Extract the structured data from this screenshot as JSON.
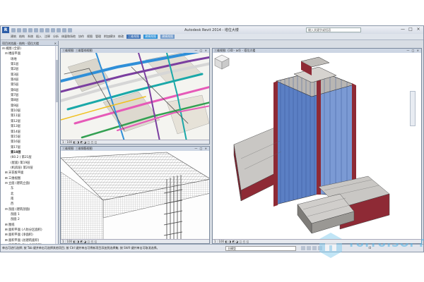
{
  "app": {
    "logo": "R",
    "title": "Autodesk Revit 2014 - 塔位大楼",
    "search_placeholder": "输入关键字或短语",
    "window_controls": [
      "—",
      "□",
      "×"
    ]
  },
  "ribbon": {
    "tabs": [
      {
        "label": "建筑",
        "style": ""
      },
      {
        "label": "结构",
        "style": ""
      },
      {
        "label": "系统",
        "style": ""
      },
      {
        "label": "插入",
        "style": ""
      },
      {
        "label": "注释",
        "style": ""
      },
      {
        "label": "分析",
        "style": ""
      },
      {
        "label": "体量和场地",
        "style": ""
      },
      {
        "label": "协作",
        "style": ""
      },
      {
        "label": "视图",
        "style": ""
      },
      {
        "label": "管理",
        "style": ""
      },
      {
        "label": "附加模块",
        "style": ""
      },
      {
        "label": "修改",
        "style": ""
      },
      {
        "label": "三维视图",
        "style": "hl"
      },
      {
        "label": "建模视图",
        "style": "hl2"
      },
      {
        "label": "建模视图",
        "style": "hl3"
      }
    ]
  },
  "browser": {
    "title": "项目浏览器 - 结构 - 塔位大楼",
    "close": "×",
    "items": [
      {
        "label": "⊟ 视图 (全部)",
        "indent": 0,
        "selected": false
      },
      {
        "label": "⊟ 楼层平面",
        "indent": 1,
        "selected": false
      },
      {
        "label": "场地",
        "indent": 3,
        "selected": false
      },
      {
        "label": "第1层",
        "indent": 3,
        "selected": false
      },
      {
        "label": "第2层",
        "indent": 3,
        "selected": false
      },
      {
        "label": "第3层",
        "indent": 3,
        "selected": false
      },
      {
        "label": "第4层",
        "indent": 3,
        "selected": false
      },
      {
        "label": "第5层",
        "indent": 3,
        "selected": false
      },
      {
        "label": "第6层",
        "indent": 3,
        "selected": false
      },
      {
        "label": "第7层",
        "indent": 3,
        "selected": false
      },
      {
        "label": "第8层",
        "indent": 3,
        "selected": false
      },
      {
        "label": "第9层",
        "indent": 3,
        "selected": false
      },
      {
        "label": "第10层",
        "indent": 3,
        "selected": false
      },
      {
        "label": "第11层",
        "indent": 3,
        "selected": false
      },
      {
        "label": "第12层",
        "indent": 3,
        "selected": false
      },
      {
        "label": "第13层",
        "indent": 3,
        "selected": false
      },
      {
        "label": "第14层",
        "indent": 3,
        "selected": false
      },
      {
        "label": "第15层",
        "indent": 3,
        "selected": false
      },
      {
        "label": "第16层",
        "indent": 3,
        "selected": false
      },
      {
        "label": "第17层",
        "indent": 3,
        "selected": false
      },
      {
        "label": "第18层",
        "indent": 3,
        "selected": true
      },
      {
        "label": "(60.2 ) 第21层",
        "indent": 3,
        "selected": false
      },
      {
        "label": "(屋面) 第19层",
        "indent": 3,
        "selected": false
      },
      {
        "label": "(机房层) 第20层",
        "indent": 3,
        "selected": false
      },
      {
        "label": "⊞ 天花板平面",
        "indent": 1,
        "selected": false
      },
      {
        "label": "⊞ 三维视图",
        "indent": 1,
        "selected": false
      },
      {
        "label": "⊟ 立面 (建筑立面)",
        "indent": 1,
        "selected": false
      },
      {
        "label": "东",
        "indent": 3,
        "selected": false
      },
      {
        "label": "北",
        "indent": 3,
        "selected": false
      },
      {
        "label": "南",
        "indent": 3,
        "selected": false
      },
      {
        "label": "西",
        "indent": 3,
        "selected": false
      },
      {
        "label": "⊟ 剖面 (建筑剖面)",
        "indent": 1,
        "selected": false
      },
      {
        "label": "剖面 1",
        "indent": 3,
        "selected": false
      },
      {
        "label": "剖面 2",
        "indent": 3,
        "selected": false
      },
      {
        "label": "⊞ 图纸",
        "indent": 1,
        "selected": false
      },
      {
        "label": "⊞ 面积平面 (人防分区面积)",
        "indent": 1,
        "selected": false
      },
      {
        "label": "⊞ 面积平面 (净面积)",
        "indent": 1,
        "selected": false
      },
      {
        "label": "⊞ 面积平面 (总建筑面积)",
        "indent": 1,
        "selected": false
      },
      {
        "label": "⊞ 面积平面 (防火分区面积)",
        "indent": 1,
        "selected": false
      }
    ]
  },
  "views": {
    "mep": {
      "title": "三维视图: 三维管线视图",
      "controls": "— □ ×",
      "bar": "1 : 100  ◧ ◨ ◩ ◪ ◫ ◰ ◱"
    },
    "rebar": {
      "title": "三维视图: 三维钢筋视图",
      "controls": "— □ ×",
      "bar": "1 : 100  ◧ ◨ ◩ ◪ ◫ ◰ ◱"
    },
    "building": {
      "title": "三维视图: {3D - ad} - 塔位大楼",
      "controls": "— □ ×",
      "bar": "1 : 100  ◧ ◨ ◩ ◪ ◫ ◰ ◱"
    }
  },
  "status": {
    "hint": "单击可进行选择; 按 Tab 键并单击可选择其他项目; 按 Ctrl 键并单击可将新项目添加到选择集; 按 Shift 键并单击可取消选择。",
    "combo": "主模型",
    "zero": ":0"
  },
  "watermark": {
    "text": "TUITUISOFT"
  },
  "colors": {
    "accent": "#3a6fb5",
    "brick": "#8e2a35",
    "glass": "#5b7fc4"
  }
}
